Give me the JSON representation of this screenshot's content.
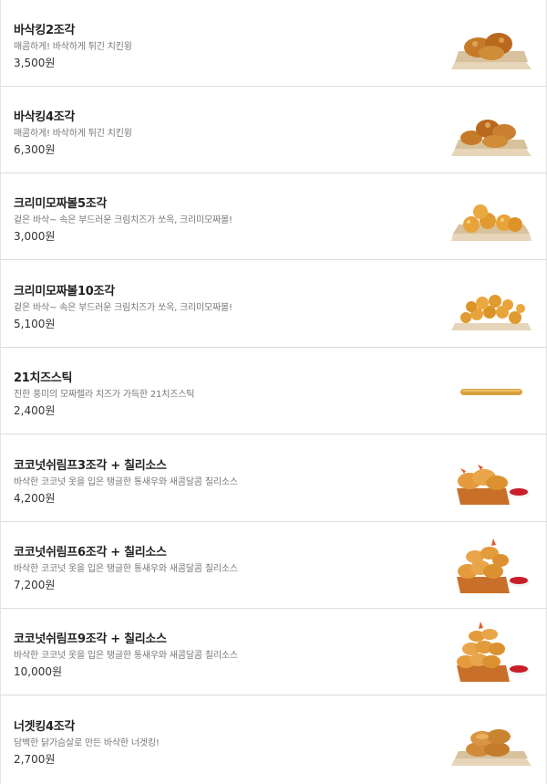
{
  "menu": {
    "items": [
      {
        "name": "바삭킹2조각",
        "description": "매콤하게! 바삭하게 튀긴 치킨윙",
        "price": "3,500원",
        "image": "crispy-wings-2-image"
      },
      {
        "name": "바삭킹4조각",
        "description": "매콤하게! 바삭하게 튀긴 치킨윙",
        "price": "6,300원",
        "image": "crispy-wings-4-image"
      },
      {
        "name": "크리미모짜볼5조각",
        "description": "겉은 바삭~ 속은 부드러운 크림치즈가 쏘옥, 크리미모짜볼!",
        "price": "3,000원",
        "image": "mozza-balls-5-image"
      },
      {
        "name": "크리미모짜볼10조각",
        "description": "겉은 바삭~ 속은 부드러운 크림치즈가 쏘옥, 크리미모짜볼!",
        "price": "5,100원",
        "image": "mozza-balls-10-image"
      },
      {
        "name": "21치즈스틱",
        "description": "진한 풍미의 모짜렐라 치즈가 가득한 21치즈스틱",
        "price": "2,400원",
        "image": "cheese-stick-image"
      },
      {
        "name": "코코넛쉬림프3조각 + 칠리소스",
        "description": "바삭한 코코넛 옷을 입은 탱글한 통새우와 새콤달콤 칠리소스",
        "price": "4,200원",
        "image": "coconut-shrimp-3-image"
      },
      {
        "name": "코코넛쉬림프6조각 + 칠리소스",
        "description": "바삭한 코코넛 옷을 입은 탱글한 통새우와 새콤달콤 칠리소스",
        "price": "7,200원",
        "image": "coconut-shrimp-6-image"
      },
      {
        "name": "코코넛쉬림프9조각 + 칠리소스",
        "description": "바삭한 코코넛 옷을 입은 탱글한 통새우와 새콤달콤 칠리소스",
        "price": "10,000원",
        "image": "coconut-shrimp-9-image"
      },
      {
        "name": "너겟킹4조각",
        "description": "담백한 닭가슴살로 만든 바삭한 너겟킹!",
        "price": "2,700원",
        "image": "nugget-king-4-image"
      }
    ]
  }
}
